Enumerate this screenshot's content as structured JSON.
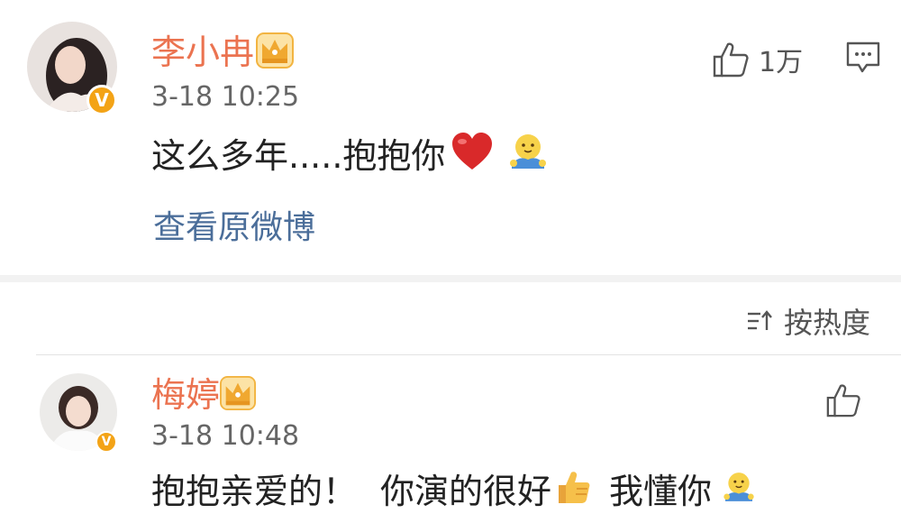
{
  "post": {
    "username": "李小冉",
    "time": "3-18 10:25",
    "text": "这么多年.....抱抱你",
    "emojis": [
      "heart-emoji",
      "hug-emoji"
    ],
    "likes": "1万",
    "view_original": "查看原微博"
  },
  "sort": {
    "label": "按热度"
  },
  "reply": {
    "username": "梅婷",
    "time": "3-18 10:48",
    "text_part1": "抱抱亲爱的！",
    "text_part2": "你演的很好",
    "text_part3": "我懂你",
    "emojis": [
      "thumbs-up-emoji",
      "hug-emoji"
    ]
  },
  "colors": {
    "username": "#eb7350",
    "link": "#4b6e9a",
    "badge": "#f3a316",
    "section_gap": "#f2f2f2"
  }
}
